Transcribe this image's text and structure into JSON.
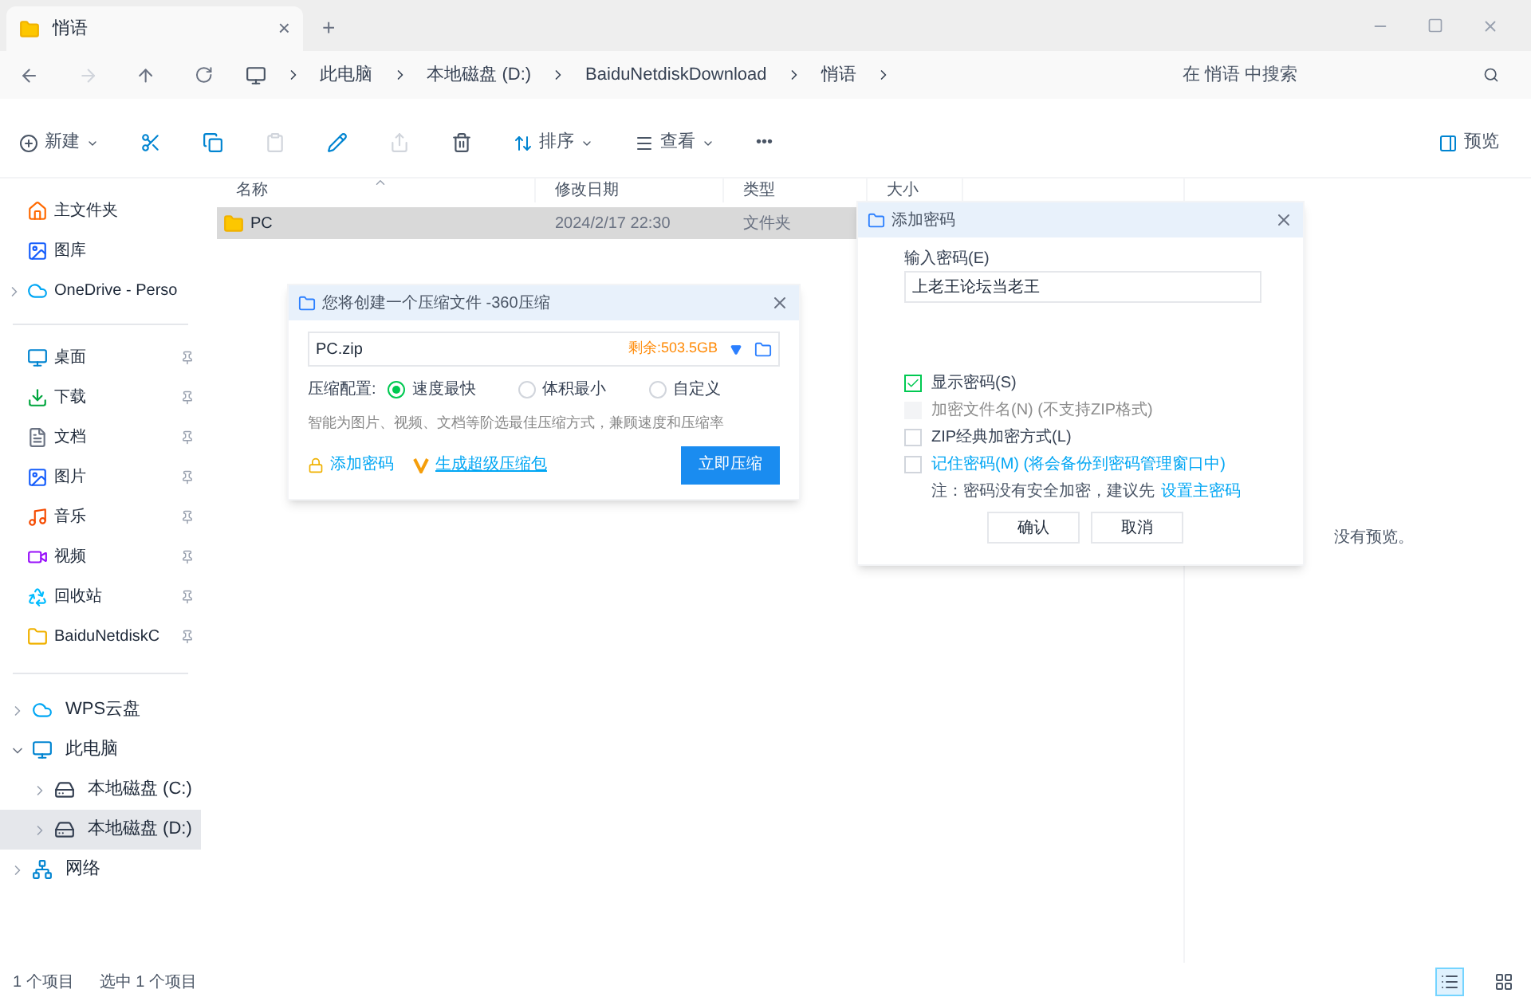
{
  "tab": {
    "title": "悄语",
    "close": "×",
    "new": "+"
  },
  "address": {
    "crumbs": [
      "此电脑",
      "本地磁盘 (D:)",
      "BaiduNetdiskDownload",
      "悄语"
    ],
    "search_placeholder": "在 悄语 中搜索"
  },
  "toolbar": {
    "new": "新建",
    "sort": "排序",
    "view": "查看",
    "more": "•••",
    "preview": "预览"
  },
  "sidebar": {
    "quick": [
      {
        "label": "主文件夹"
      },
      {
        "label": "图库"
      },
      {
        "label": "OneDrive - Perso",
        "expandable": true
      }
    ],
    "pinned": [
      {
        "label": "桌面",
        "pinned": true
      },
      {
        "label": "下载",
        "pinned": true
      },
      {
        "label": "文档",
        "pinned": true
      },
      {
        "label": "图片",
        "pinned": true
      },
      {
        "label": "音乐",
        "pinned": true
      },
      {
        "label": "视频",
        "pinned": true
      },
      {
        "label": "回收站",
        "pinned": true
      },
      {
        "label": "BaiduNetdiskC",
        "pinned": true
      }
    ],
    "tree": [
      {
        "label": "WPS云盘",
        "expanded": false,
        "selected": false
      },
      {
        "label": "此电脑",
        "expanded": true,
        "selected": false,
        "children": [
          {
            "label": "本地磁盘 (C:)",
            "expanded": false,
            "selected": false
          },
          {
            "label": "本地磁盘 (D:)",
            "expanded": false,
            "selected": true
          }
        ]
      },
      {
        "label": "网络",
        "expanded": false,
        "selected": false
      }
    ]
  },
  "table": {
    "columns": [
      "名称",
      "修改日期",
      "类型",
      "大小"
    ],
    "rows": [
      {
        "name": "PC",
        "date": "2024/2/17 22:30",
        "type": "文件夹",
        "selected": true
      }
    ]
  },
  "preview_pane": {
    "message": "没有预览。"
  },
  "status_bar": {
    "count": "1 个项目",
    "selection": "选中 1 个项目",
    "views": [
      {
        "kind": "details",
        "selected": true
      },
      {
        "kind": "tiles",
        "selected": false
      }
    ]
  },
  "compress_dialog": {
    "title": "您将创建一个压缩文件 -360压缩",
    "filename": "PC.zip",
    "free_space": "剩余:503.5GB",
    "config_label": "压缩配置:",
    "options": [
      {
        "label": "速度最快",
        "selected": true
      },
      {
        "label": "体积最小",
        "selected": false
      },
      {
        "label": "自定义",
        "selected": false
      }
    ],
    "hint": "智能为图片、视频、文档等阶选最佳压缩方式，兼顾速度和压缩率",
    "add_password": "添加密码",
    "make_package": "生成超级压缩包",
    "submit": "立即压缩"
  },
  "password_dialog": {
    "title": "添加密码",
    "field_label": "输入密码(E)",
    "value": "上老王论坛当老王",
    "checks": [
      {
        "label": "显示密码(S)",
        "checked": true,
        "disabled": false
      },
      {
        "label": "加密文件名(N)",
        "note": "(不支持ZIP格式)",
        "checked": false,
        "disabled": true
      },
      {
        "label": "ZIP经典加密方式(L)",
        "checked": false,
        "disabled": false
      },
      {
        "label": "记住密码(M)",
        "note": "(将会备份到密码管理窗口中)",
        "checked": false,
        "disabled": false,
        "link": true
      }
    ],
    "notice": "注：密码没有安全加密，建议先",
    "notice_link": "设置主密码",
    "ok": "确认",
    "cancel": "取消"
  }
}
